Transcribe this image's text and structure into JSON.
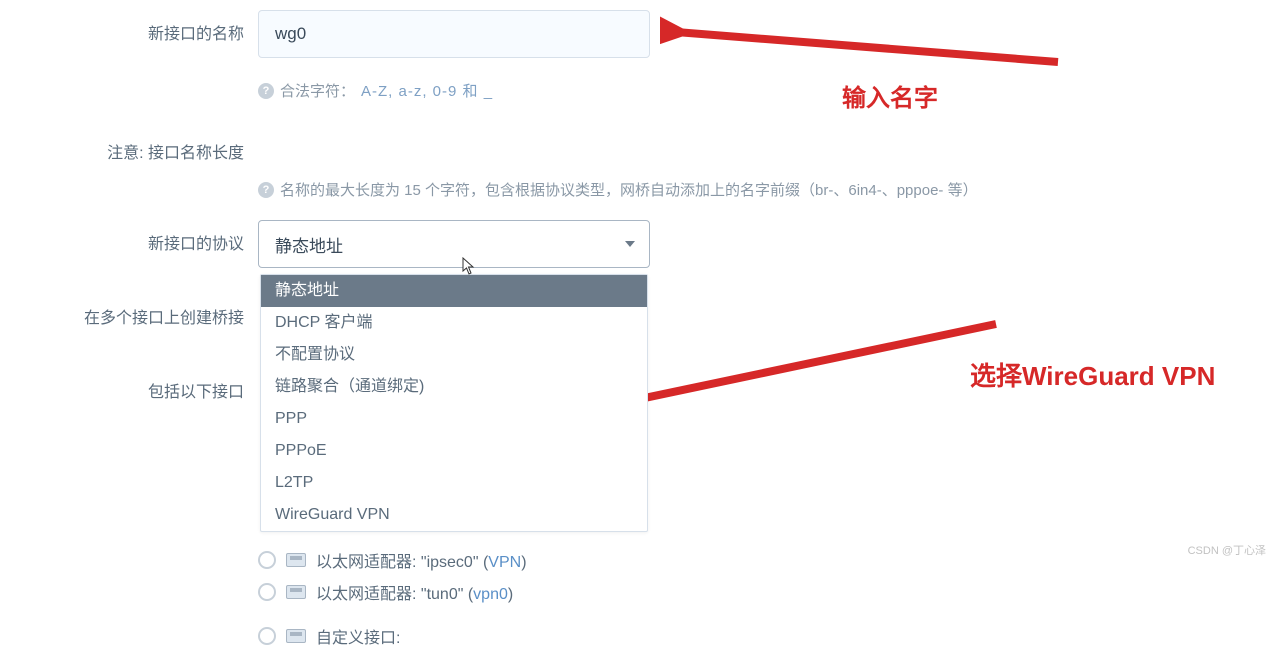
{
  "labels": {
    "name": "新接口的名称",
    "notice": "注意: 接口名称长度",
    "protocol": "新接口的协议",
    "bridge": "在多个接口上创建桥接",
    "include": "包括以下接口"
  },
  "name_input": {
    "value": "wg0"
  },
  "help": {
    "legal_prefix": "合法字符：",
    "legal_chars": "A-Z, a-z, 0-9 和 _",
    "maxlen": "名称的最大长度为 15 个字符，包含根据协议类型，网桥自动添加上的名字前缀（br-、6in4-、pppoe- 等）"
  },
  "protocol": {
    "selected": "静态地址",
    "options": [
      "静态地址",
      "DHCP 客户端",
      "不配置协议",
      "链路聚合（通道绑定)",
      "PPP",
      "PPPoE",
      "L2TP",
      "WireGuard VPN"
    ]
  },
  "interfaces": [
    {
      "text_a": "以太网适配器: \"ipsec0\" (",
      "paren": "VPN",
      "text_b": ")"
    },
    {
      "text_a": "以太网适配器: \"tun0\" (",
      "paren": "vpn0",
      "text_b": ")"
    }
  ],
  "custom_iface_label": "自定义接口:",
  "annot": {
    "a1": "输入名字",
    "a2": "选择WireGuard VPN"
  },
  "watermark": "CSDN @丁心泽"
}
